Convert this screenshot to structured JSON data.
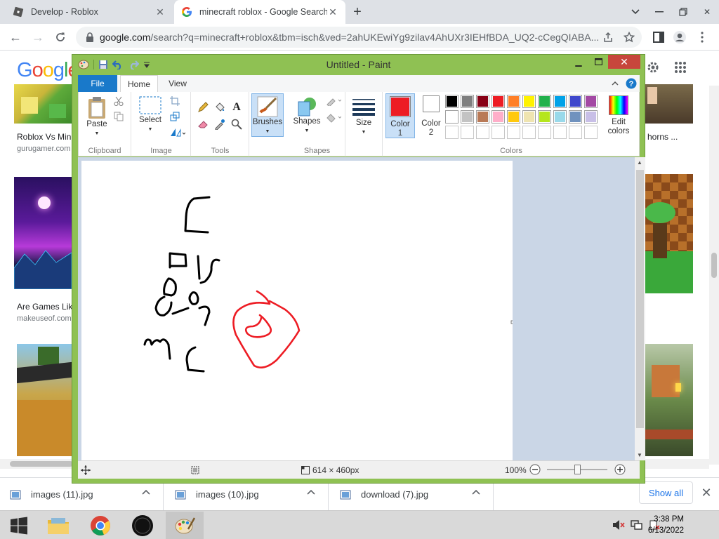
{
  "browser": {
    "tabs": [
      {
        "label": "Develop - Roblox",
        "active": false
      },
      {
        "label": "minecraft roblox - Google Search",
        "active": true
      }
    ],
    "url_domain": "google.com",
    "url_path": "/search?q=minecraft+roblox&tbm=isch&ved=2ahUKEwiYg9zilav4AhUXr3IEHfBDA_UQ2-cCegQIABA..."
  },
  "google": {
    "logo": "Google",
    "results": [
      {
        "caption": "Roblox Vs Min",
        "source": "gurugamer.com"
      },
      {
        "caption": "Are Games Lik",
        "source": "makeuseof.com"
      }
    ],
    "right_caption": "horns ..."
  },
  "downloads": {
    "items": [
      "images (11).jpg",
      "images (10).jpg",
      "download (7).jpg"
    ],
    "show_all": "Show all"
  },
  "taskbar": {
    "time": "3:38 PM",
    "date": "6/13/2022"
  },
  "paint": {
    "title": "Untitled - Paint",
    "tabs": {
      "file": "File",
      "home": "Home",
      "view": "View"
    },
    "groups": {
      "clipboard": "Clipboard",
      "image": "Image",
      "tools": "Tools",
      "shapes": "Shapes",
      "colors": "Colors"
    },
    "buttons": {
      "paste": "Paste",
      "select": "Select",
      "brushes": "Brushes",
      "shapes": "Shapes",
      "size": "Size",
      "color1": "Color\n1",
      "color1_a": "Color",
      "color1_b": "1",
      "color2_a": "Color",
      "color2_b": "2",
      "edit_a": "Edit",
      "edit_b": "colors"
    },
    "color1": "#ed1c24",
    "color2": "#ffffff",
    "palette": [
      "#000000",
      "#7f7f7f",
      "#880015",
      "#ed1c24",
      "#ff7f27",
      "#fff200",
      "#22b14c",
      "#00a2e8",
      "#3f48cc",
      "#a349a4",
      "#ffffff",
      "#c3c3c3",
      "#b97a57",
      "#ffaec9",
      "#ffc90e",
      "#efe4b0",
      "#b5e61d",
      "#99d9ea",
      "#7092be",
      "#c8bfe7",
      "",
      "",
      "",
      "",
      "",
      "",
      "",
      "",
      "",
      ""
    ],
    "status": {
      "dimensions": "614 × 460px",
      "zoom": "100%"
    }
  }
}
